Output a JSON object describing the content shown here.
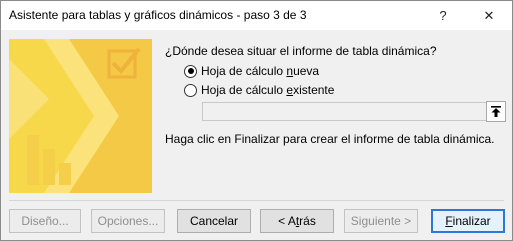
{
  "window": {
    "title": "Asistente para tablas y gráficos dinámicos - paso 3 de 3",
    "help_glyph": "?",
    "close_glyph": "✕"
  },
  "colors": {
    "accent": "#2b78d6",
    "art_yellow": "#f8d84b",
    "art_light": "#fbe985",
    "art_orange": "#f0b23c"
  },
  "icons": {
    "wizard_art": "pivot-wizard-illustration",
    "range_picker": "collapse-dialog-arrow-icon"
  },
  "prompt": {
    "question": "¿Dónde desea situar el informe de tabla dinámica?",
    "hint": "Haga clic en Finalizar para crear el informe de tabla dinámica."
  },
  "options": {
    "new_sheet_pre": "Hoja de cálculo ",
    "new_sheet_ul": "n",
    "new_sheet_post": "ueva",
    "existing_pre": "Hoja de cálculo ",
    "existing_ul": "e",
    "existing_post": "xistente",
    "selected": "new_sheet"
  },
  "range_input": {
    "value": ""
  },
  "buttons": {
    "design": "Diseño...",
    "options": "Opciones...",
    "cancel": "Cancelar",
    "back_pre": "< A",
    "back_ul": "t",
    "back_post": "rás",
    "next": "Siguiente >",
    "finish_ul": "F",
    "finish_post": "inalizar"
  }
}
